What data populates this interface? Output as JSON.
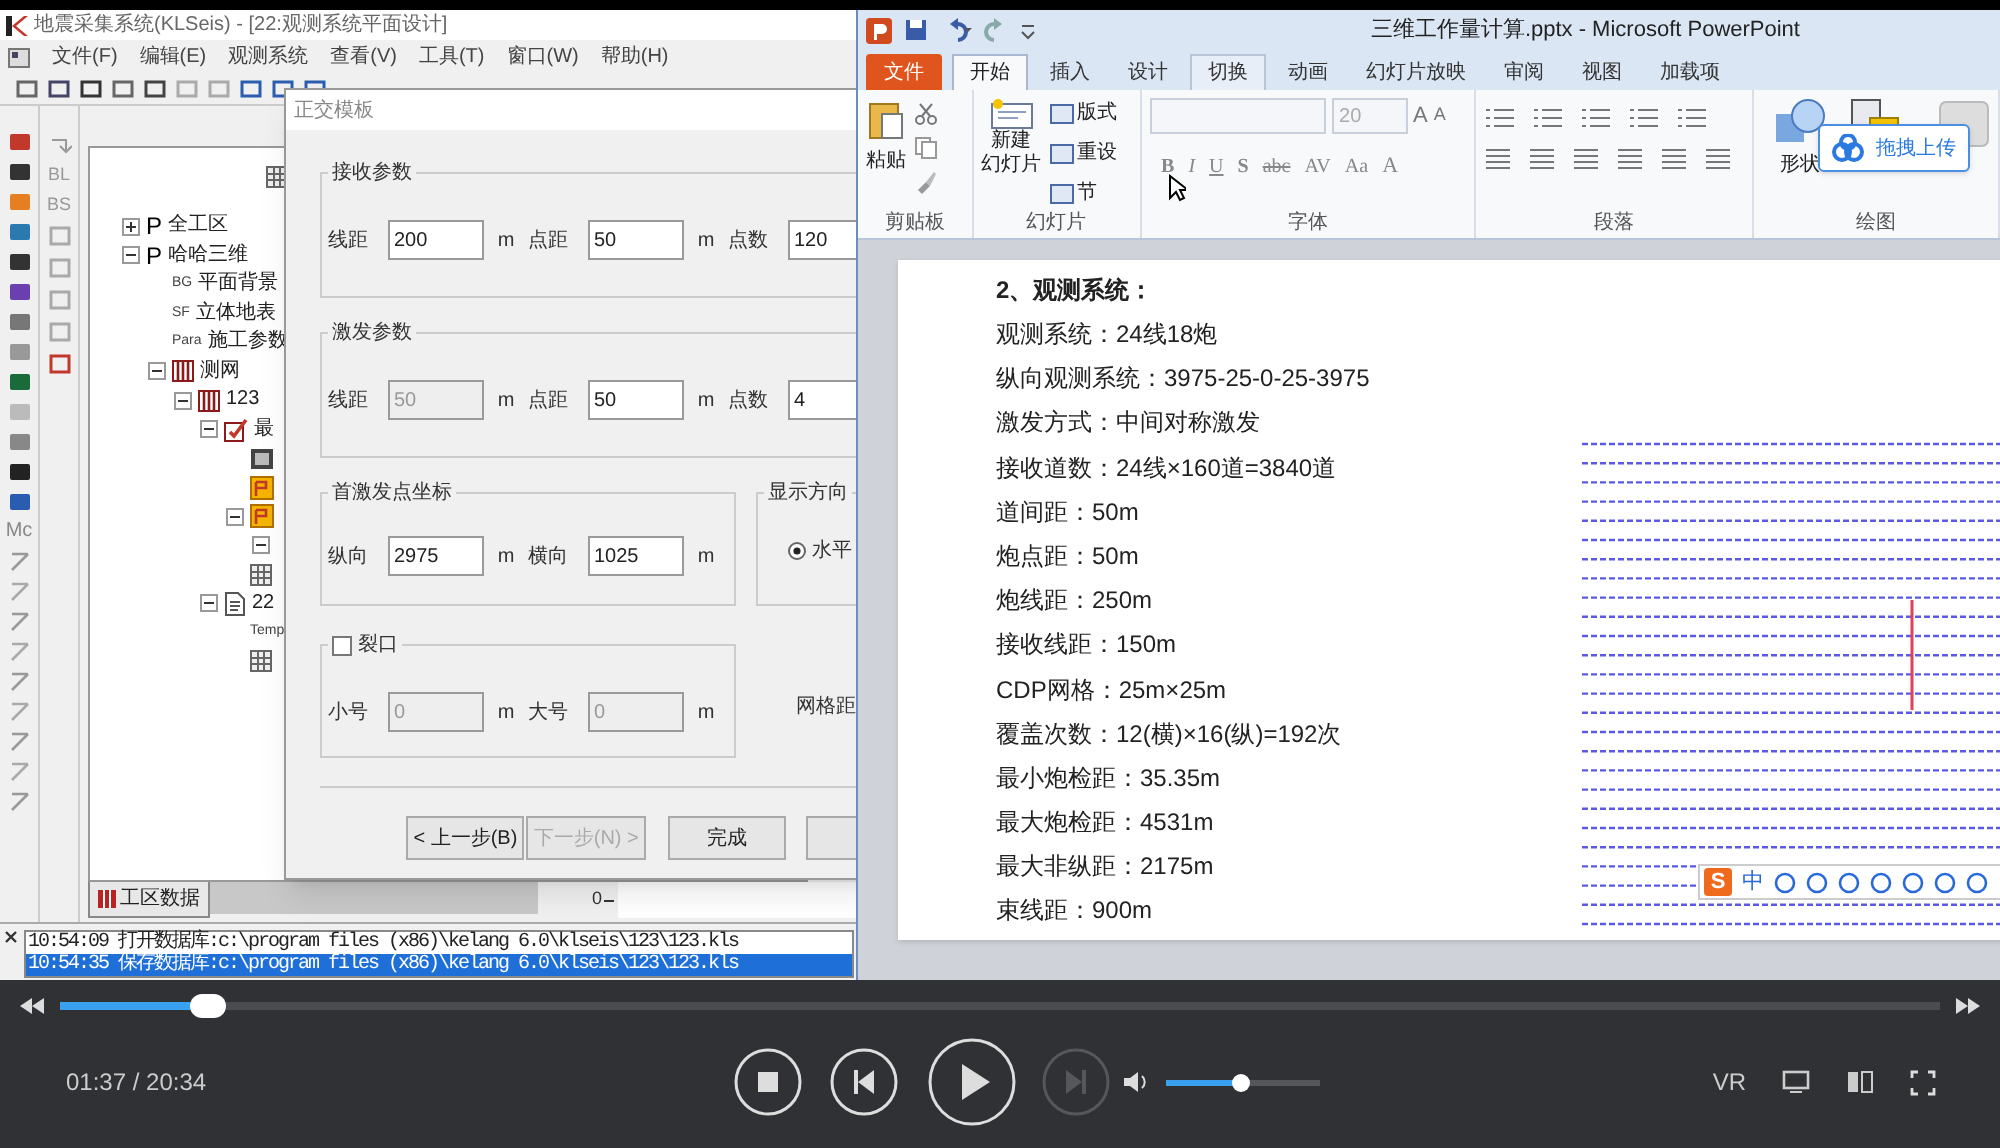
{
  "klseis": {
    "title": "地震采集系统(KLSeis) - [22:观测系统平面设计]",
    "menu": [
      "文件(F)",
      "编辑(E)",
      "观测系统",
      "查看(V)",
      "工具(T)",
      "窗口(W)",
      "帮助(H)"
    ],
    "side_labels_1": [
      "Mc"
    ],
    "side_labels_2": [
      "BL",
      "BS"
    ],
    "tree_top": {
      "kind": "table"
    },
    "tree": [
      {
        "kind": "project",
        "prefix": "P",
        "label": "全工区",
        "expanded": false
      },
      {
        "kind": "project",
        "prefix": "P",
        "label": "哈哈三维",
        "expanded": true,
        "children": [
          {
            "kind": "tag",
            "prefix": "BG",
            "label": "平面背景"
          },
          {
            "kind": "tag",
            "prefix": "SF",
            "label": "立体地表"
          },
          {
            "kind": "tag",
            "prefix": "Para",
            "label": "施工参数"
          },
          {
            "kind": "grid",
            "label": "测网",
            "expanded": true,
            "children": [
              {
                "kind": "grid",
                "label": "123",
                "expanded": true,
                "children": [
                  {
                    "kind": "check",
                    "label": "最",
                    "expanded": true,
                    "children": [
                      {
                        "kind": "image"
                      },
                      {
                        "kind": "flag"
                      },
                      {
                        "kind": "flag",
                        "expanded": true,
                        "children": [
                          {
                            "expanded": true
                          }
                        ]
                      },
                      {
                        "kind": "table"
                      }
                    ]
                  },
                  {
                    "kind": "doc",
                    "label": "22",
                    "expanded": true,
                    "children": [
                      {
                        "kind": "tag",
                        "prefix": "Temp"
                      },
                      {
                        "kind": "table"
                      }
                    ]
                  }
                ]
              }
            ]
          }
        ]
      }
    ],
    "bottom_tab": "工区数据",
    "ruler_tick": "0",
    "log": [
      {
        "text": "10:54:09 打开数据库:c:\\program files (x86)\\kelang 6.0\\klseis\\123\\123.kls",
        "selected": false
      },
      {
        "text": "10:54:35 保存数据库:c:\\program files (x86)\\kelang 6.0\\klseis\\123\\123.kls",
        "selected": true
      }
    ]
  },
  "dialog": {
    "title": "正交模板",
    "receive": {
      "legend": "接收参数",
      "fields": [
        {
          "label": "线距",
          "value": "200",
          "unit": "m",
          "disabled": false
        },
        {
          "label": "点距",
          "value": "50",
          "unit": "m",
          "disabled": false
        },
        {
          "label": "点数",
          "value": "120",
          "disabled": false
        }
      ]
    },
    "shot": {
      "legend": "激发参数",
      "fields": [
        {
          "label": "线距",
          "value": "50",
          "unit": "m",
          "disabled": true
        },
        {
          "label": "点距",
          "value": "50",
          "unit": "m",
          "disabled": false
        },
        {
          "label": "点数",
          "value": "4",
          "disabled": false
        }
      ]
    },
    "first_shot": {
      "legend": "首激发点坐标",
      "fields": [
        {
          "label": "纵向",
          "value": "2975",
          "unit": "m",
          "disabled": false
        },
        {
          "label": "横向",
          "value": "1025",
          "unit": "m",
          "disabled": false
        }
      ]
    },
    "direction": {
      "legend": "显示方向",
      "option": {
        "label": "水平",
        "selected": true
      }
    },
    "gap": {
      "legend": "裂口",
      "checked": false,
      "fields": [
        {
          "label": "小号",
          "value": "0",
          "unit": "m",
          "disabled": true
        },
        {
          "label": "大号",
          "value": "0",
          "unit": "m",
          "disabled": true
        }
      ]
    },
    "grid_label": "网格距",
    "buttons": [
      {
        "label": "< 上一步(B)",
        "disabled": false
      },
      {
        "label": "下一步(N) >",
        "disabled": true
      },
      {
        "label": "完成",
        "disabled": false
      }
    ]
  },
  "powerpoint": {
    "title": "三维工作量计算.pptx - Microsoft PowerPoint",
    "tabs": [
      {
        "label": "文件",
        "kind": "file",
        "selected": false,
        "hovered": false
      },
      {
        "label": "开始",
        "kind": "tab",
        "selected": true,
        "hovered": false
      },
      {
        "label": "插入",
        "kind": "tab",
        "selected": false,
        "hovered": false
      },
      {
        "label": "设计",
        "kind": "tab",
        "selected": false,
        "hovered": false
      },
      {
        "label": "切换",
        "kind": "tab",
        "selected": false,
        "hovered": true
      },
      {
        "label": "动画",
        "kind": "tab",
        "selected": false,
        "hovered": false
      },
      {
        "label": "幻灯片放映",
        "kind": "tab",
        "selected": false,
        "hovered": false
      },
      {
        "label": "审阅",
        "kind": "tab",
        "selected": false,
        "hovered": false
      },
      {
        "label": "视图",
        "kind": "tab",
        "selected": false,
        "hovered": false
      },
      {
        "label": "加载项",
        "kind": "tab",
        "selected": false,
        "hovered": false
      }
    ],
    "paste": "粘贴",
    "new_slide": [
      "新建",
      "幻灯片"
    ],
    "layout": "版式",
    "reset": "重设",
    "section": "节",
    "font_size": "20",
    "grow_font": "A",
    "shrink_font": "A",
    "font_buttons": [
      "B",
      "I",
      "U",
      "S",
      "abc",
      "AV",
      "Aa"
    ],
    "font_color": "A",
    "shapes": "形状",
    "group_labels": [
      "剪贴板",
      "幻灯片",
      "字体",
      "段落",
      "绘图"
    ],
    "upload_popup": "拖拽上传"
  },
  "slide": {
    "heading": "2、观测系统：",
    "lines": [
      "观测系统：24线18炮",
      "纵向观测系统：3975-25-0-25-3975",
      "激发方式：中间对称激发",
      "接收道数：24线×160道=3840道",
      "道间距：50m",
      "炮点距：50m",
      "炮线距：250m",
      "接收线距：150m",
      "CDP网格：25m×25m",
      "覆盖次数：12(横)×16(纵)=192次",
      "最小炮检距：35.35m",
      "最大炮检距：4531m",
      "最大非纵距：2175m",
      "束线距：900m"
    ]
  },
  "ime_toolbar": {
    "logo": "S",
    "mode": "中"
  },
  "player": {
    "time": "01:37 / 20:34",
    "progress": {
      "level": 0.079
    },
    "volume": {
      "level": 0.48
    },
    "next_disabled": true,
    "vr": "VR"
  }
}
